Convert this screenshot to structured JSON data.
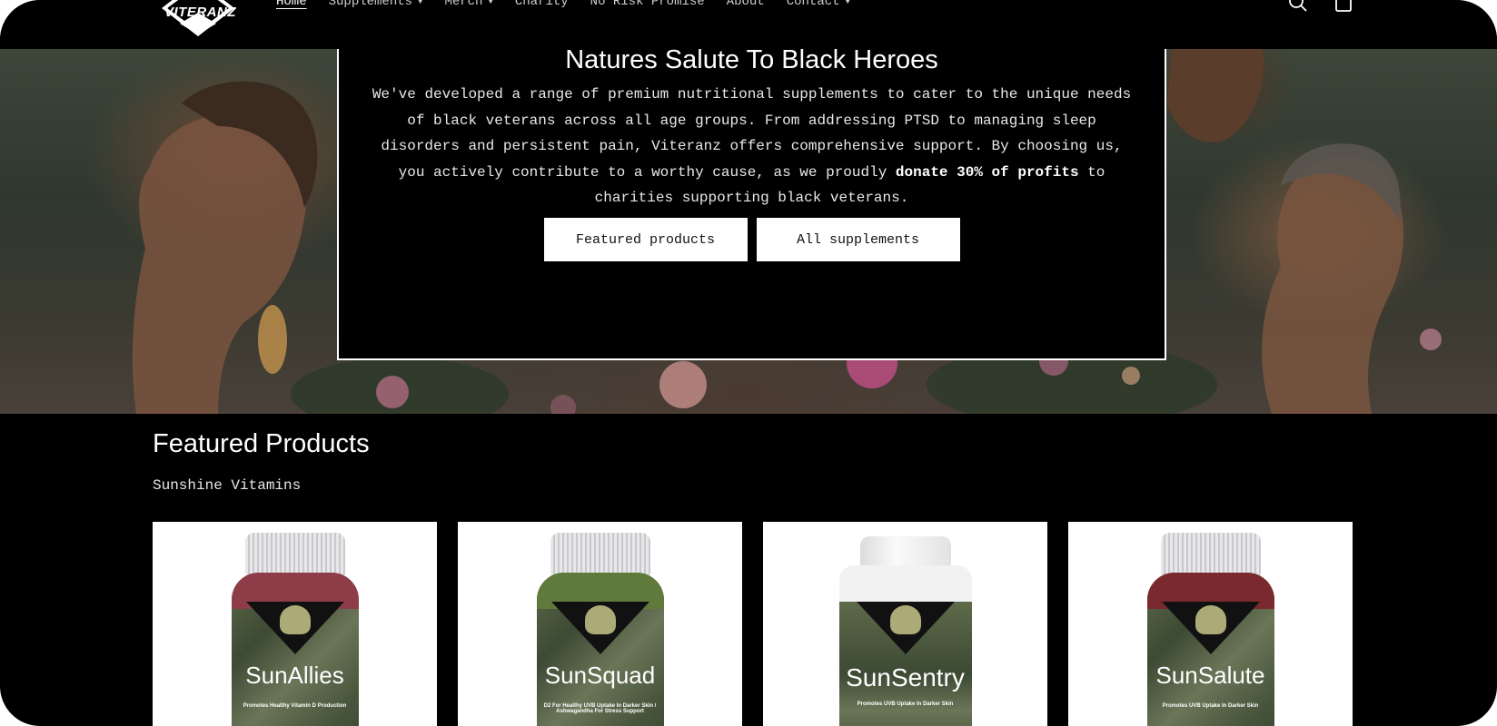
{
  "header": {
    "logo_text": "VITERANZ",
    "nav": [
      {
        "label": "Home",
        "active": true,
        "dropdown": false
      },
      {
        "label": "Supplements",
        "active": false,
        "dropdown": true
      },
      {
        "label": "Merch",
        "active": false,
        "dropdown": true
      },
      {
        "label": "Charity",
        "active": false,
        "dropdown": false
      },
      {
        "label": "No Risk Promise",
        "active": false,
        "dropdown": false
      },
      {
        "label": "About",
        "active": false,
        "dropdown": false
      },
      {
        "label": "Contact",
        "active": false,
        "dropdown": true
      }
    ],
    "icons": [
      "search-icon",
      "cart-icon"
    ]
  },
  "hero": {
    "title": "Natures Salute To Black Heroes",
    "body_part1": "We've developed a range of premium nutritional supplements to cater to the unique needs of black veterans across all age groups. From addressing PTSD to managing sleep disorders and persistent pain, Viteranz offers comprehensive support.  By choosing us, you actively contribute to a worthy cause, as we proudly ",
    "body_bold": "donate 30% of profits",
    "body_part2": " to charities supporting black veterans.",
    "buttons": [
      {
        "label": "Featured products"
      },
      {
        "label": "All supplements"
      }
    ]
  },
  "featured": {
    "title": "Featured Products",
    "subtitle": "Sunshine Vitamins",
    "products": [
      {
        "name": "SunAllies",
        "tagline": "Promotes Healthy Vitamin D Production",
        "gummy_color": "#8e3d48",
        "cap": "clear"
      },
      {
        "name": "SunSquad",
        "tagline": "D2 For Healthy UVB Uptake In Darker Skin / Ashwagandha For Stress Support",
        "gummy_color": "#5f7a3a",
        "cap": "clear"
      },
      {
        "name": "SunSentry",
        "tagline": "Promotes UVB Uptake In Darker Skin",
        "gummy_color": "",
        "cap": "white"
      },
      {
        "name": "SunSalute",
        "tagline": "Promotes UVB Uptake In Darker Skin",
        "gummy_color": "#7a2a2e",
        "cap": "clear"
      }
    ]
  },
  "colors": {
    "background": "#000000",
    "button_bg": "#ffffff",
    "text": "#ffffff"
  }
}
